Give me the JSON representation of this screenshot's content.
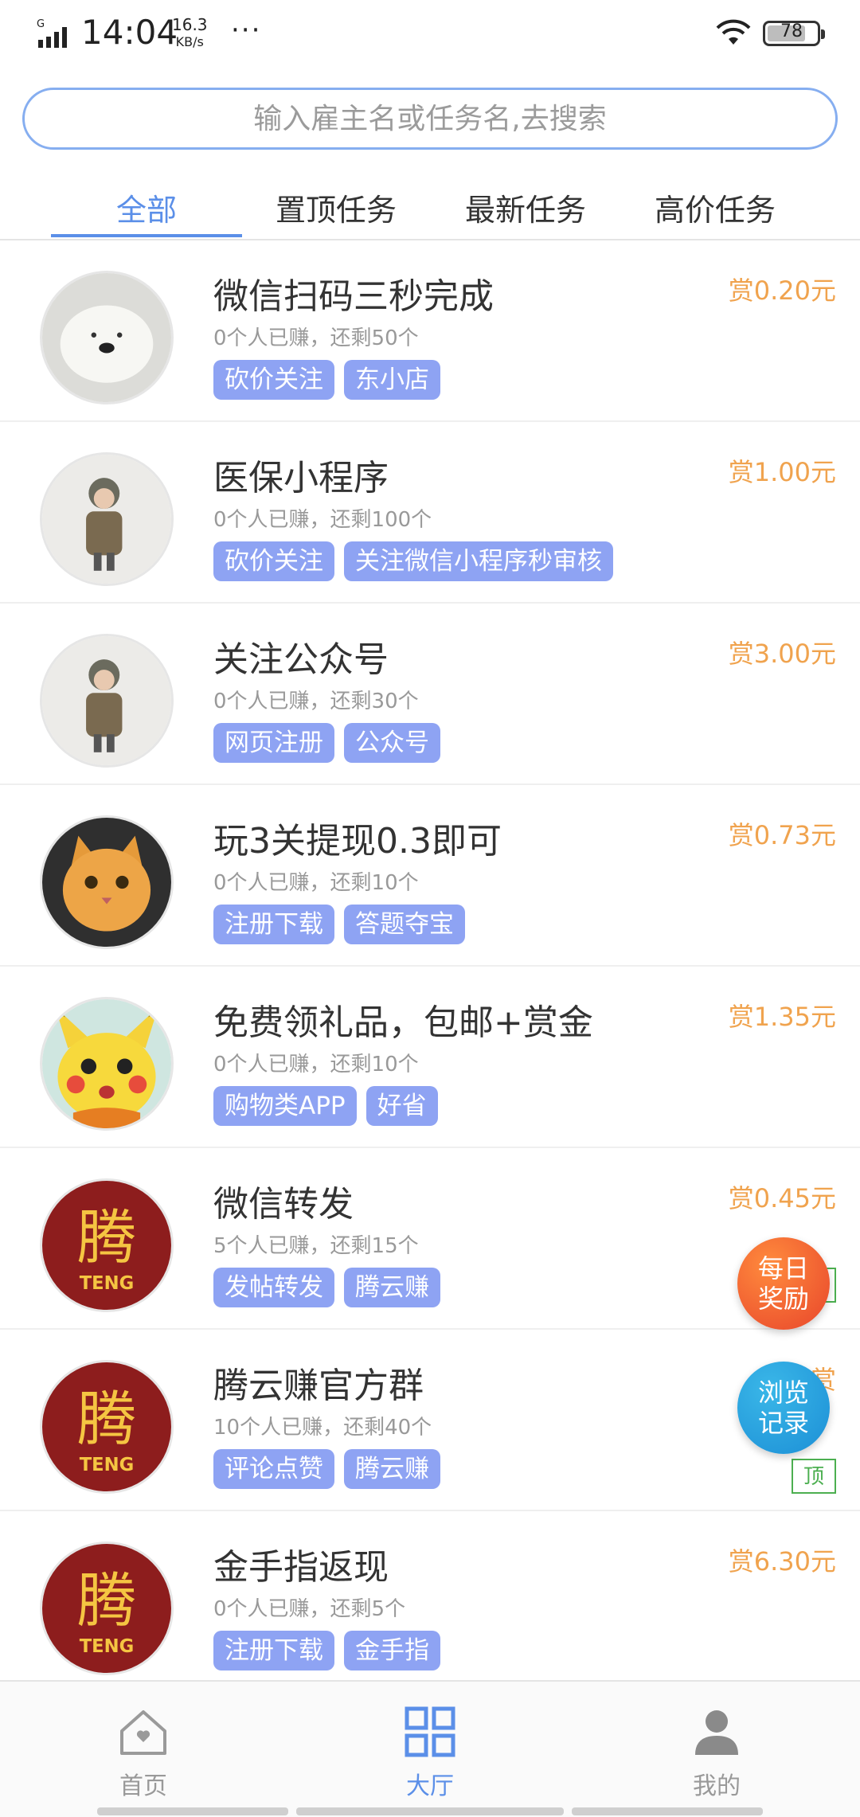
{
  "status_bar": {
    "network": "G",
    "time": "14:04",
    "speed_value": "16.3",
    "speed_unit": "KB/s",
    "more": "···",
    "battery": "78",
    "battery_level": 0.78
  },
  "search": {
    "placeholder": "输入雇主名或任务名,去搜索"
  },
  "tabs": [
    {
      "label": "全部",
      "active": true
    },
    {
      "label": "置顶任务"
    },
    {
      "label": "最新任务"
    },
    {
      "label": "高价任务"
    }
  ],
  "tasks": [
    {
      "title": "微信扫码三秒完成",
      "reward": "赏0.20元",
      "meta": "0个人已赚，还剩50个",
      "tags": [
        "砍价关注",
        "东小店"
      ],
      "avatar": "white-dog-icon"
    },
    {
      "title": "医保小程序",
      "reward": "赏1.00元",
      "meta": "0个人已赚，还剩100个",
      "tags": [
        "砍价关注",
        "关注微信小程序秒审核"
      ],
      "avatar": "child-photo-icon"
    },
    {
      "title": "关注公众号",
      "reward": "赏3.00元",
      "meta": "0个人已赚，还剩30个",
      "tags": [
        "网页注册",
        "公众号"
      ],
      "avatar": "child-photo-icon"
    },
    {
      "title": "玩3关提现0.3即可",
      "reward": "赏0.73元",
      "meta": "0个人已赚，还剩10个",
      "tags": [
        "注册下载",
        "答题夺宝"
      ],
      "avatar": "orange-cat-icon"
    },
    {
      "title": "免费领礼品，包邮+赏金",
      "reward": "赏1.35元",
      "meta": "0个人已赚，还剩10个",
      "tags": [
        "购物类APP",
        "好省"
      ],
      "avatar": "pikachu-icon"
    },
    {
      "title": "微信转发",
      "reward": "赏0.45元",
      "meta": "5个人已赚，还剩15个",
      "tags": [
        "发帖转发",
        "腾云赚"
      ],
      "avatar": "teng-logo-icon",
      "badge": "顶"
    },
    {
      "title": "腾云赚官方群",
      "reward": "赏",
      "meta": "10个人已赚，还剩40个",
      "tags": [
        "评论点赞",
        "腾云赚"
      ],
      "avatar": "teng-logo-icon",
      "badge": "顶"
    },
    {
      "title": "金手指返现",
      "reward": "赏6.30元",
      "meta": "0个人已赚，还剩5个",
      "tags": [
        "注册下载",
        "金手指"
      ],
      "avatar": "teng-logo-icon"
    }
  ],
  "floating": {
    "daily_line1": "每日",
    "daily_line2": "奖励",
    "history_line1": "浏览",
    "history_line2": "记录"
  },
  "bottom_nav": [
    {
      "label": "首页",
      "icon": "home-icon"
    },
    {
      "label": "大厅",
      "icon": "grid-icon",
      "active": true
    },
    {
      "label": "我的",
      "icon": "user-icon"
    }
  ],
  "colors": {
    "accent": "#5b8fe8",
    "reward": "#f0a34e",
    "tag": "#8ea3f3",
    "badge": "#4caf50"
  }
}
